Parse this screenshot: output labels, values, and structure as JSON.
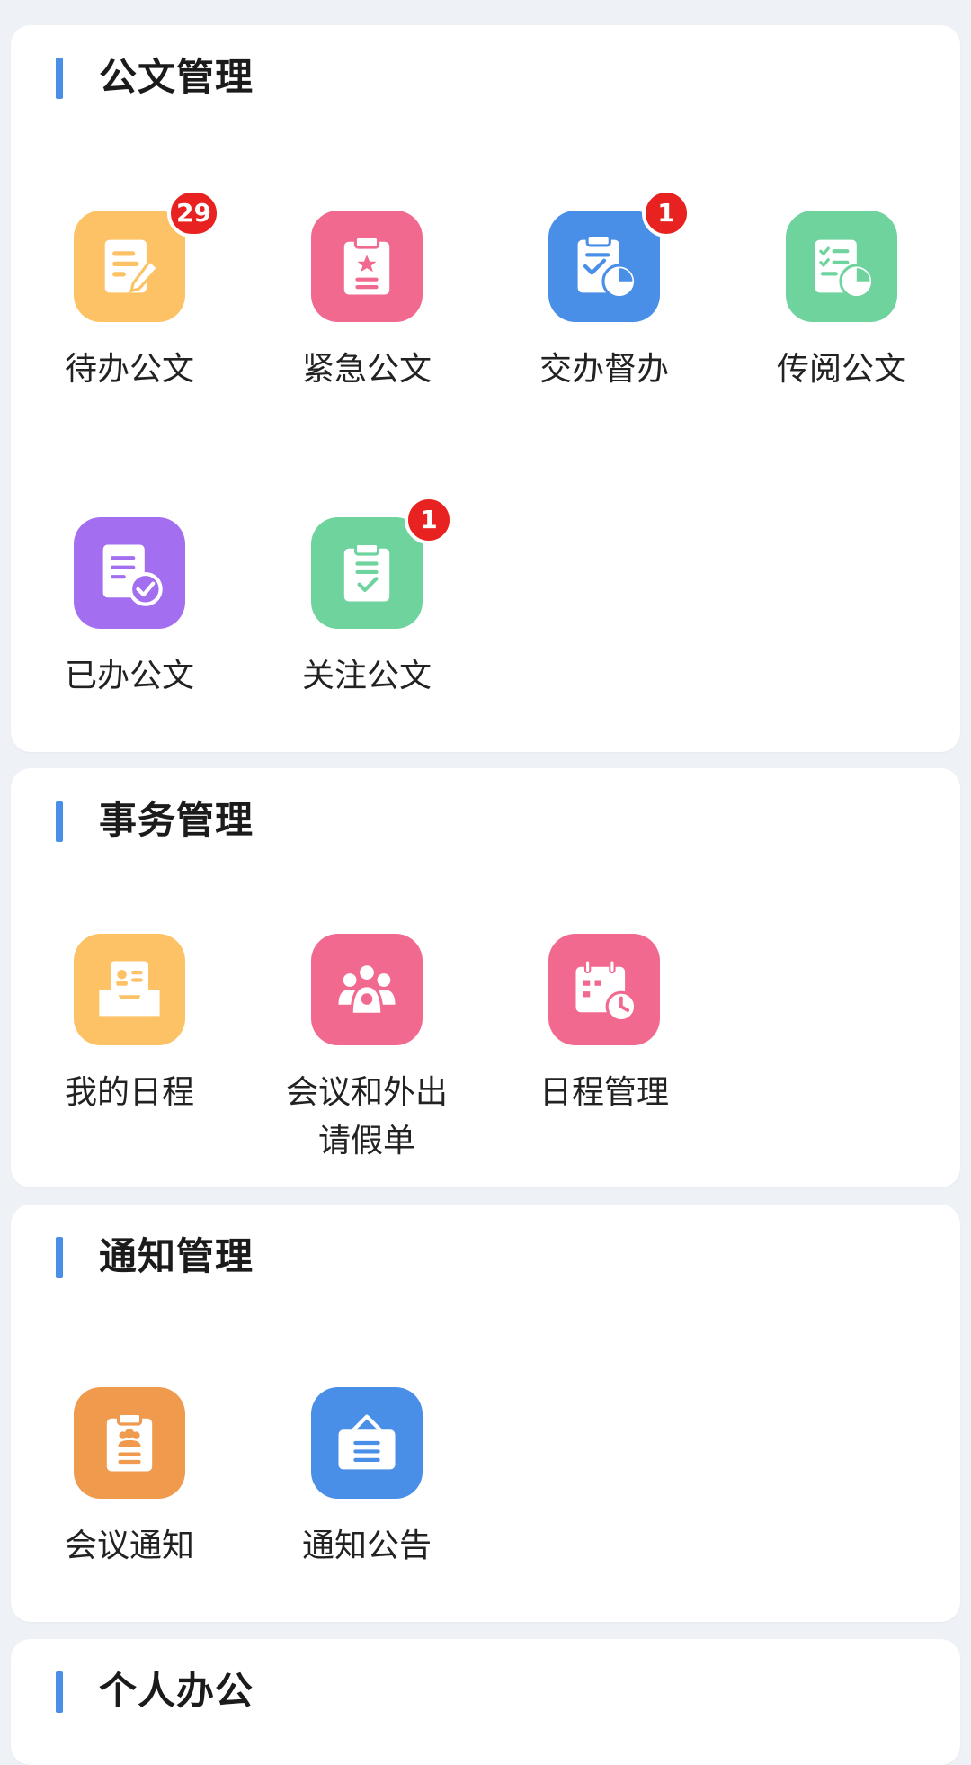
{
  "colors": {
    "accent": "#4a8fe7",
    "badge": "#e82121",
    "yellow": "#fdc265",
    "pink": "#f2698f",
    "blue": "#4a8fe7",
    "green": "#6fd39e",
    "purple": "#a36ef0",
    "orange": "#ef9a4c"
  },
  "sections": [
    {
      "title": "公文管理",
      "items": [
        {
          "label": "待办公文",
          "icon": "document-edit-icon",
          "badge": "29"
        },
        {
          "label": "紧急公文",
          "icon": "clipboard-star-icon"
        },
        {
          "label": "交办督办",
          "icon": "clipboard-chart-icon",
          "badge": "1"
        },
        {
          "label": "传阅公文",
          "icon": "list-chart-icon"
        },
        {
          "label": "已办公文",
          "icon": "document-check-icon"
        },
        {
          "label": "关注公文",
          "icon": "clipboard-check-icon",
          "badge": "1"
        }
      ]
    },
    {
      "title": "事务管理",
      "items": [
        {
          "label": "我的日程",
          "icon": "inbox-card-icon"
        },
        {
          "label": "会议和外出\n请假单",
          "icon": "group-meeting-icon"
        },
        {
          "label": "日程管理",
          "icon": "calendar-clock-icon"
        }
      ]
    },
    {
      "title": "通知管理",
      "items": [
        {
          "label": "会议通知",
          "icon": "clipboard-people-icon"
        },
        {
          "label": "通知公告",
          "icon": "notice-board-icon"
        }
      ]
    },
    {
      "title": "个人办公",
      "items": []
    }
  ]
}
